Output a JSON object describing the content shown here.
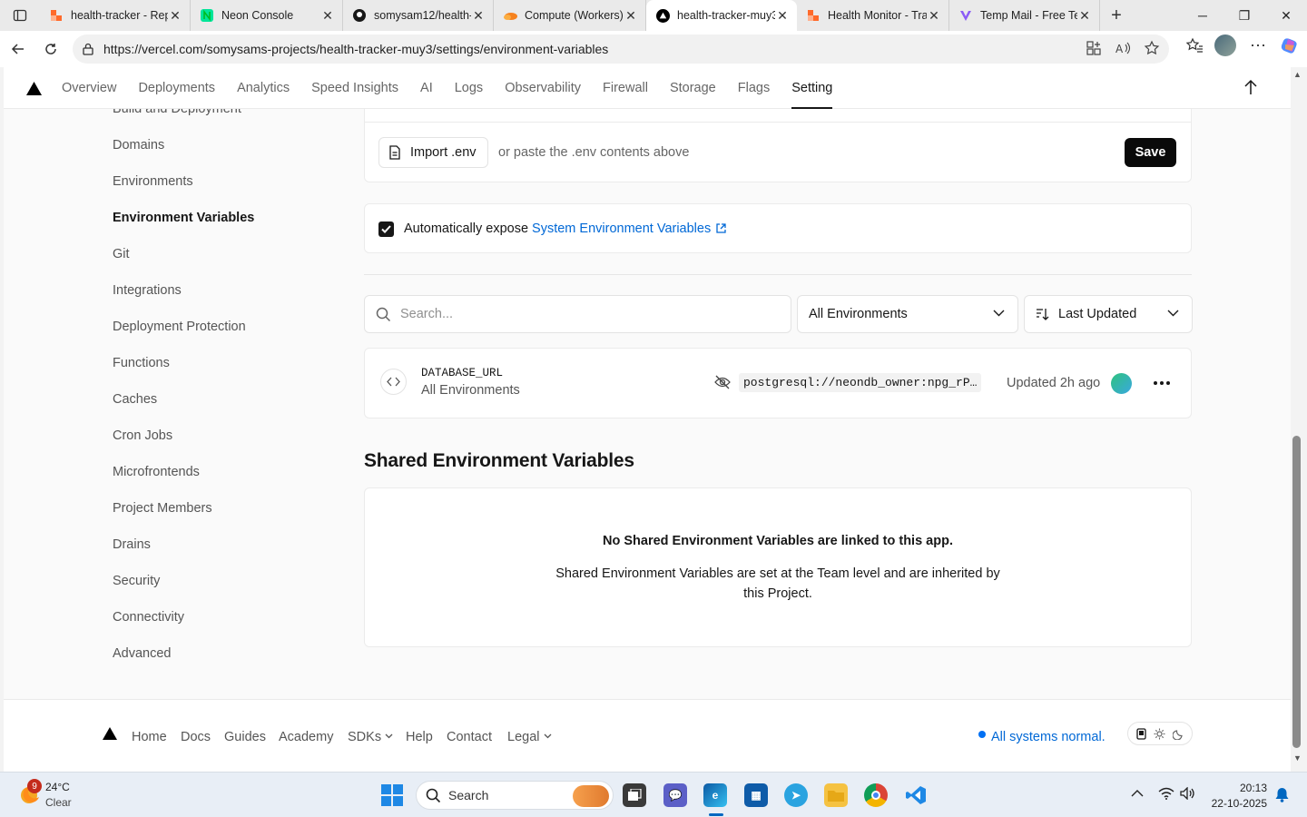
{
  "browser": {
    "tabs": [
      {
        "title": "health-tracker - Rep",
        "active": false
      },
      {
        "title": "Neon Console",
        "active": false
      },
      {
        "title": "somysam12/health-",
        "active": false
      },
      {
        "title": "Compute (Workers)",
        "active": false
      },
      {
        "title": "health-tracker-muy3",
        "active": true
      },
      {
        "title": "Health Monitor - Tra",
        "active": false
      },
      {
        "title": "Temp Mail - Free Te",
        "active": false
      }
    ],
    "url": "https://vercel.com/somysams-projects/health-tracker-muy3/settings/environment-variables"
  },
  "topnav": {
    "items": [
      "Overview",
      "Deployments",
      "Analytics",
      "Speed Insights",
      "AI",
      "Logs",
      "Observability",
      "Firewall",
      "Storage",
      "Flags",
      "Setting"
    ],
    "selected": "Setting"
  },
  "sidebar": {
    "items": [
      "Build and Deployment",
      "Domains",
      "Environments",
      "Environment Variables",
      "Git",
      "Integrations",
      "Deployment Protection",
      "Functions",
      "Caches",
      "Cron Jobs",
      "Microfrontends",
      "Project Members",
      "Drains",
      "Security",
      "Connectivity",
      "Advanced"
    ],
    "selected": "Environment Variables"
  },
  "import": {
    "button_label": "Import .env",
    "hint": "or paste the .env contents above",
    "save_label": "Save"
  },
  "expose": {
    "checked": true,
    "label": "Automatically expose",
    "link": "System Environment Variables"
  },
  "filters": {
    "search_placeholder": "Search...",
    "environment_select": "All Environments",
    "sort_select": "Last Updated"
  },
  "env_vars": [
    {
      "name": "DATABASE_URL",
      "scope": "All Environments",
      "value": "postgresql://neondb_owner:npg_rP…",
      "updated": "Updated 2h ago"
    }
  ],
  "shared": {
    "heading": "Shared Environment Variables",
    "empty_title": "No Shared Environment Variables are linked to this app.",
    "empty_body": "Shared Environment Variables are set at the Team level and are inherited by this Project."
  },
  "footer": {
    "links": [
      "Home",
      "Docs",
      "Guides",
      "Academy",
      "SDKs",
      "Help",
      "Contact",
      "Legal"
    ],
    "status": "All systems normal.",
    "status_color": "#0070f3"
  },
  "taskbar": {
    "weather_temp": "24°C",
    "weather_desc": "Clear",
    "weather_badge": "9",
    "search_label": "Search",
    "time": "20:13",
    "date": "22-10-2025"
  }
}
